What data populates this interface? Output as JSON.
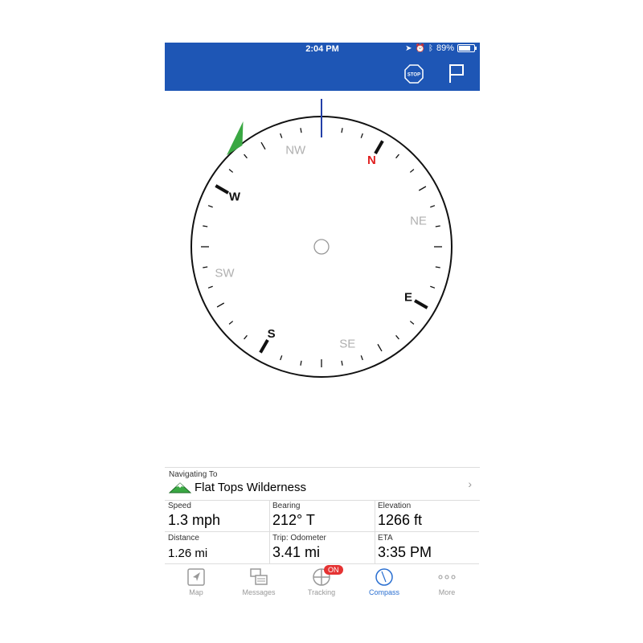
{
  "status_bar": {
    "time": "2:04 PM",
    "battery": "89%",
    "battery_level": 0.89
  },
  "compass": {
    "labels": [
      {
        "text": "N",
        "angle": 30,
        "color": "#e02020",
        "radius": 0.77,
        "bold": true
      },
      {
        "text": "NE",
        "angle": 75,
        "color": "#b0b0b0",
        "radius": 0.77,
        "bold": false
      },
      {
        "text": "E",
        "angle": 120,
        "color": "#111111",
        "radius": 0.77,
        "bold": true
      },
      {
        "text": "SE",
        "angle": 165,
        "color": "#b0b0b0",
        "radius": 0.77,
        "bold": false
      },
      {
        "text": "S",
        "angle": 210,
        "color": "#111111",
        "radius": 0.77,
        "bold": true
      },
      {
        "text": "SW",
        "angle": 255,
        "color": "#b0b0b0",
        "radius": 0.77,
        "bold": false
      },
      {
        "text": "W",
        "angle": 300,
        "color": "#111111",
        "radius": 0.77,
        "bold": true
      },
      {
        "text": "NW",
        "angle": 345,
        "color": "#b0b0b0",
        "radius": 0.77,
        "bold": false
      }
    ],
    "rotation_offset_deg": 30,
    "destination_marker_angle": -38,
    "colors": {
      "ring": "#111111",
      "needle": "#2440a8",
      "marker": "#3aa843",
      "north": "#e02020"
    }
  },
  "navigation": {
    "label": "Navigating To",
    "destination": "Flat Tops Wilderness",
    "stats": [
      {
        "label": "Speed",
        "value": "1.3 mph",
        "small": false
      },
      {
        "label": "Bearing",
        "value": "212° T",
        "small": false
      },
      {
        "label": "Elevation",
        "value": "1266 ft",
        "small": false
      },
      {
        "label": "Distance",
        "value": "1.26 mi",
        "small": true
      },
      {
        "label": "Trip: Odometer",
        "value": "3.41 mi",
        "small": false
      },
      {
        "label": "ETA",
        "value": "3:35 PM",
        "small": false
      }
    ]
  },
  "header": {
    "stop_label": "STOP"
  },
  "tabs": [
    {
      "label": "Map",
      "icon": "map-arrow-icon",
      "active": false
    },
    {
      "label": "Messages",
      "icon": "messages-icon",
      "active": false
    },
    {
      "label": "Tracking",
      "icon": "tracking-icon",
      "active": false,
      "badge": "ON"
    },
    {
      "label": "Compass",
      "icon": "compass-icon",
      "active": true
    },
    {
      "label": "More",
      "icon": "more-dots-icon",
      "active": false
    }
  ]
}
